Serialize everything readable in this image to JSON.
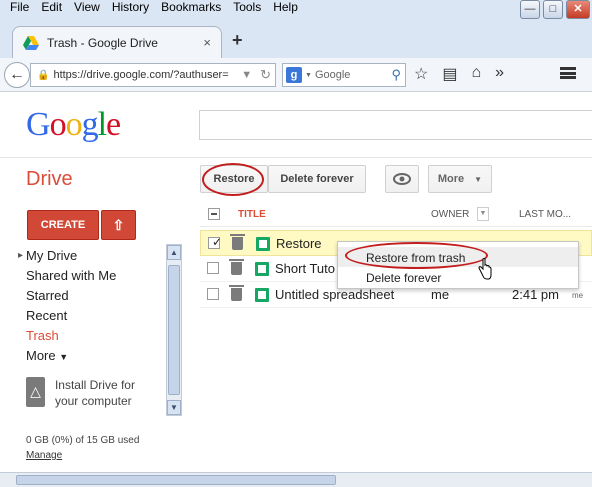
{
  "menubar": [
    "File",
    "Edit",
    "View",
    "History",
    "Bookmarks",
    "Tools",
    "Help"
  ],
  "window_controls": [
    "—",
    "□",
    "✕"
  ],
  "tab": {
    "title": "Trash - Google Drive",
    "close": "×"
  },
  "new_tab": "+",
  "navbar": {
    "url": "https://drive.google.com/?authuser=",
    "search_engine": "Google",
    "icons": [
      "star-icon",
      "bookmarks-list-icon",
      "home-icon",
      "overflow-icon",
      "menu-icon"
    ]
  },
  "google_logo": {
    "letters": [
      "G",
      "o",
      "o",
      "g",
      "l",
      "e"
    ],
    "colors": [
      "#3369e8",
      "#d50f25",
      "#eeb211",
      "#3369e8",
      "#009925",
      "#d50f25"
    ]
  },
  "drive": {
    "title": "Drive",
    "toolbar": {
      "restore": "Restore",
      "delete_forever": "Delete forever",
      "more": "More"
    }
  },
  "sidebar": {
    "create": "CREATE",
    "items": [
      {
        "label": "My Drive"
      },
      {
        "label": "Shared with Me"
      },
      {
        "label": "Starred"
      },
      {
        "label": "Recent"
      },
      {
        "label": "Trash"
      },
      {
        "label": "More"
      }
    ],
    "install": "Install Drive for your computer",
    "storage": "0 GB (0%) of 15 GB used",
    "manage": "Manage"
  },
  "list": {
    "headers": {
      "title": "TITLE",
      "owner": "OWNER",
      "last_modified": "LAST MO..."
    },
    "rows": [
      {
        "name": "Restore",
        "owner": "",
        "date": "",
        "selected": true
      },
      {
        "name": "Short Tuto",
        "owner": "",
        "date": "",
        "selected": false
      },
      {
        "name": "Untitled spreadsheet",
        "owner": "me",
        "date": "2:41 pm",
        "tail": "me",
        "selected": false
      }
    ]
  },
  "context_menu": {
    "items": [
      "Restore from trash",
      "Delete forever"
    ]
  },
  "colors": {
    "accent_red": "#dd4b39",
    "create_red": "#d14836",
    "sheet_green": "#16a765",
    "selected_row": "#fff9c4"
  }
}
